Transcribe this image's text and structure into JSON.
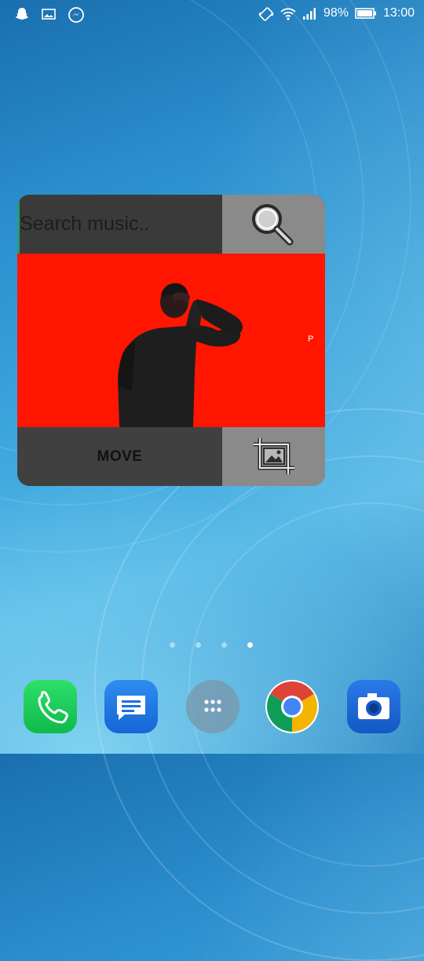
{
  "status_bar": {
    "battery": "98%",
    "time": "13:00",
    "left_icons": [
      "snapchat-icon",
      "gallery-icon",
      "messenger-icon"
    ],
    "right_icons": [
      "vibrate-icon",
      "wifi-icon",
      "signal-icon",
      "battery-icon"
    ]
  },
  "widget": {
    "search_placeholder": "Search music..",
    "art_letter": "P",
    "move_label": "MOVE",
    "colors": {
      "art_background": "#ff1500",
      "panel": "#3d3d3d",
      "button": "#8a8a8a"
    }
  },
  "pager": {
    "count": 4,
    "active_index": 3
  },
  "dock": {
    "apps": [
      "phone-app-icon",
      "messages-app-icon",
      "app-drawer-icon",
      "chrome-app-icon",
      "camera-app-icon"
    ]
  }
}
